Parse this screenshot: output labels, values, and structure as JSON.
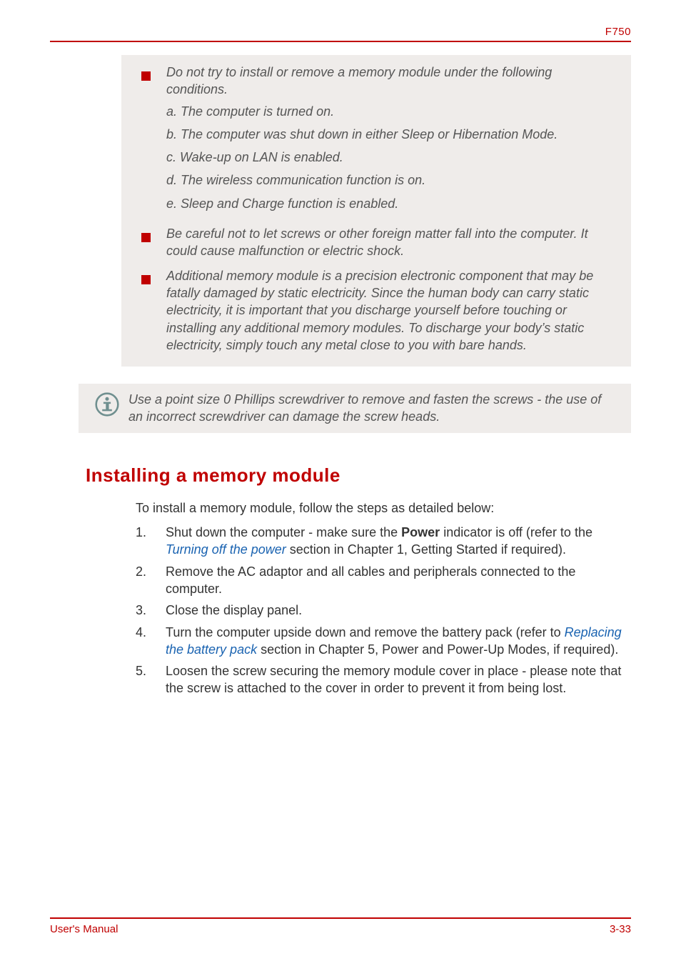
{
  "header": {
    "model": "F750"
  },
  "warnings": {
    "items": [
      {
        "lead": "Do not try to install or remove a memory module under the following conditions.",
        "sub": [
          "a. The computer is turned on.",
          "b. The computer was shut down in either Sleep or Hibernation Mode.",
          "c. Wake-up on LAN is enabled.",
          "d. The wireless communication function is on.",
          "e. Sleep and Charge function is enabled."
        ]
      },
      {
        "lead": "Be careful not to let screws or other foreign matter fall into the computer. It could cause malfunction or electric shock."
      },
      {
        "lead": "Additional memory module is a precision electronic component that may be fatally damaged by static electricity. Since the human body can carry static electricity, it is important that you discharge yourself before touching or installing any additional memory modules. To discharge your body’s static electricity, simply touch any metal close to you with bare hands."
      }
    ]
  },
  "info_icon": "info-icon",
  "info_text": "Use a point size 0 Phillips screwdriver to remove and fasten the screws - the use of an incorrect screwdriver can damage the screw heads.",
  "section": {
    "heading": "Installing a memory module",
    "intro": "To install a memory module, follow the steps as detailed below:",
    "steps": [
      {
        "pre": "Shut down the computer - make sure the ",
        "bold": "Power",
        "mid": " indicator is off (refer to the ",
        "link": "Turning off the power",
        "post": " section in Chapter 1, Getting Started if required)."
      },
      {
        "pre": "Remove the AC adaptor and all cables and peripherals connected to the computer."
      },
      {
        "pre": "Close the display panel."
      },
      {
        "pre": "Turn the computer upside down and remove the battery pack (refer to ",
        "link": "Replacing the battery pack",
        "post": " section in Chapter 5, Power and Power-Up Modes, if required)."
      },
      {
        "pre": "Loosen the screw securing the memory module cover in place - please note that the screw is attached to the cover in order to prevent it from being lost."
      }
    ]
  },
  "footer": {
    "left": "User's Manual",
    "right": "3-33"
  }
}
